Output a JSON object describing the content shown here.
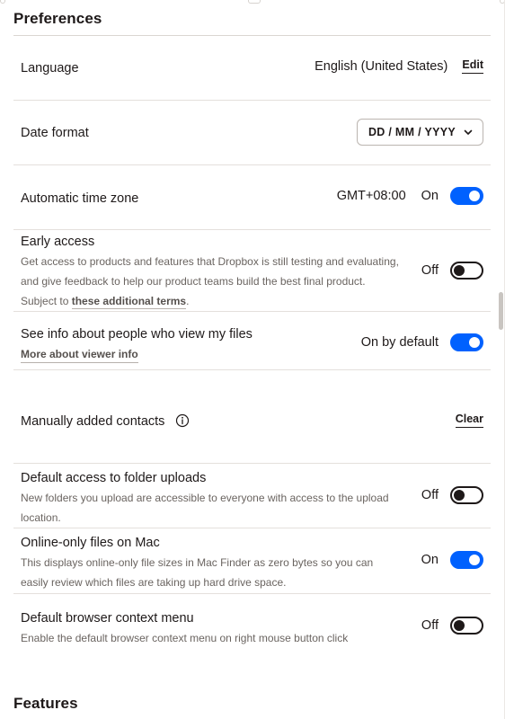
{
  "preferences": {
    "title": "Preferences",
    "language": {
      "label": "Language",
      "value": "English (United States)",
      "edit_label": "Edit"
    },
    "date_format": {
      "label": "Date format",
      "selected": "DD / MM / YYYY"
    },
    "time_zone": {
      "label": "Automatic time zone",
      "value": "GMT+08:00",
      "state": "On"
    },
    "early_access": {
      "label": "Early access",
      "desc": "Get access to products and features that Dropbox is still testing and evaluating, and give feedback to help our product teams build the best final product. Subject to",
      "link": "these additional terms",
      "link_suffix": ".",
      "state": "Off"
    },
    "viewer_info": {
      "label": "See info about people who view my files",
      "link": "More about viewer info",
      "state": "On by default"
    },
    "contacts": {
      "label": "Manually added contacts",
      "clear_label": "Clear"
    },
    "folder_uploads": {
      "label": "Default access to folder uploads",
      "desc": "New folders you upload are accessible to everyone with access to the upload location.",
      "state": "Off"
    },
    "online_only": {
      "label": "Online-only files on Mac",
      "desc": "This displays online-only file sizes in Mac Finder as zero bytes so you can easily review which files are taking up hard drive space.",
      "state": "On"
    },
    "context_menu": {
      "label": "Default browser context menu",
      "desc": "Enable the default browser context menu on right mouse button click",
      "state": "Off"
    }
  },
  "features": {
    "title": "Features"
  },
  "icons": {
    "chevron": "chevron-down-icon",
    "info": "info-icon"
  },
  "colors": {
    "accent": "#0061fe",
    "text": "#1e1919",
    "muted": "#6a6460"
  }
}
